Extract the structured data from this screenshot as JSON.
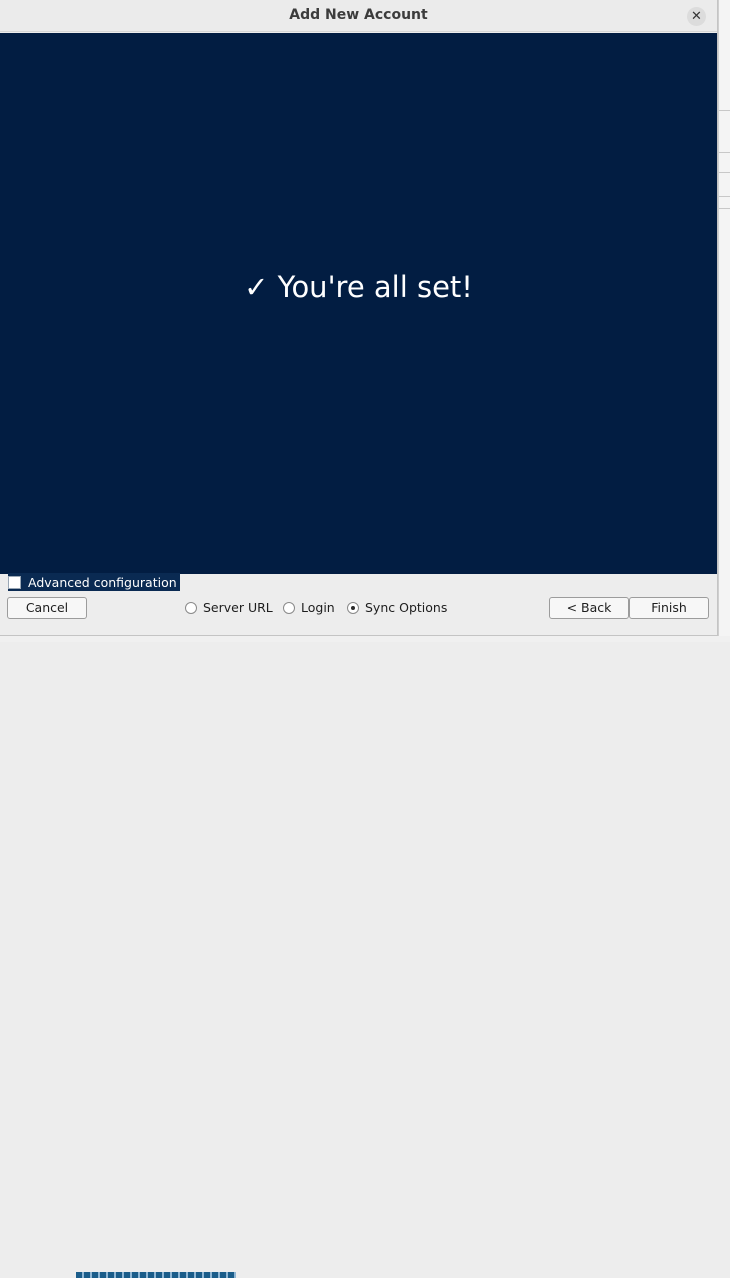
{
  "dialog": {
    "title": "Add New Account",
    "close_icon": "close-icon"
  },
  "content": {
    "message": "✓ You're all set!",
    "advanced_label": "Advanced configuration",
    "advanced_checked": false,
    "background_color": "#021d42"
  },
  "footer": {
    "cancel_label": "Cancel",
    "back_label": "< Back",
    "finish_label": "Finish",
    "steps": [
      {
        "label": "Server URL",
        "selected": false
      },
      {
        "label": "Login",
        "selected": false
      },
      {
        "label": "Sync Options",
        "selected": true
      }
    ]
  }
}
